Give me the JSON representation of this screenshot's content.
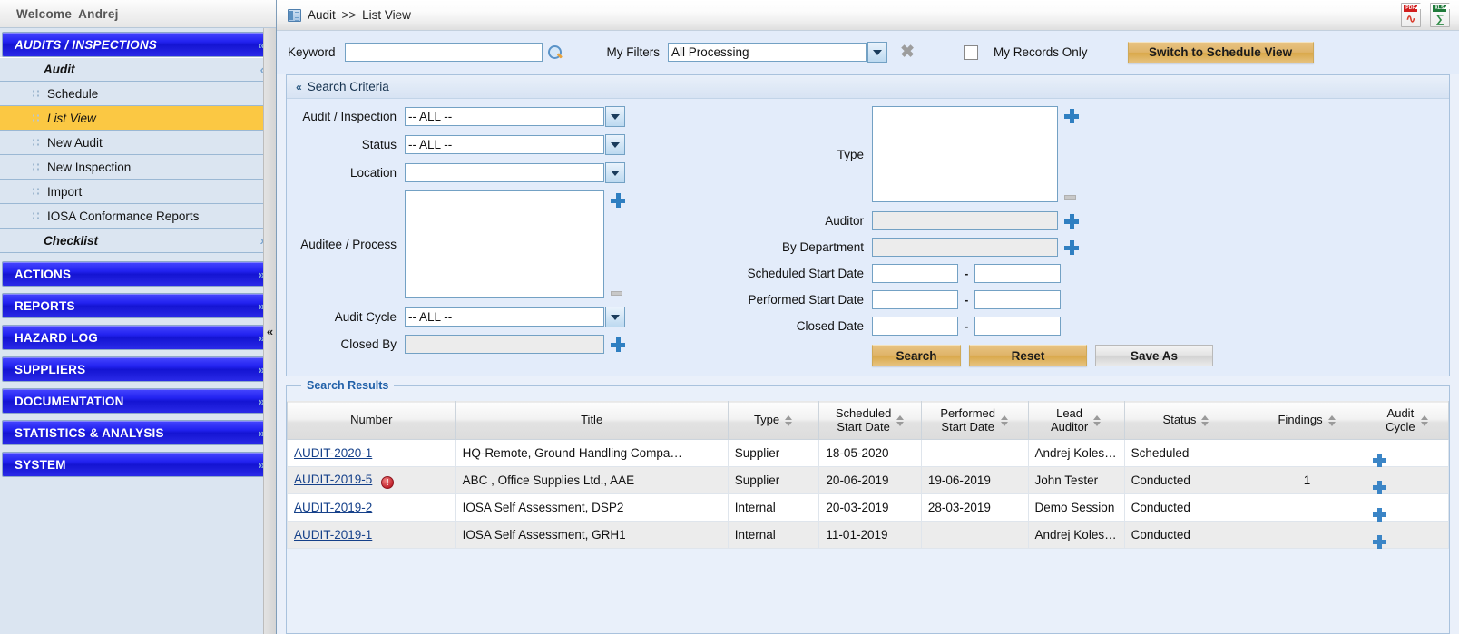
{
  "sidebar": {
    "welcome_prefix": "Welcome",
    "welcome_user": "Andrej",
    "groups": [
      {
        "label": "AUDITS / INSPECTIONS",
        "expanded": true
      },
      {
        "label": "ACTIONS",
        "expanded": false
      },
      {
        "label": "REPORTS",
        "expanded": false
      },
      {
        "label": "HAZARD LOG",
        "expanded": false
      },
      {
        "label": "SUPPLIERS",
        "expanded": false
      },
      {
        "label": "DOCUMENTATION",
        "expanded": false
      },
      {
        "label": "STATISTICS & ANALYSIS",
        "expanded": false
      },
      {
        "label": "SYSTEM",
        "expanded": false
      }
    ],
    "audit_section": "Audit",
    "checklist_section": "Checklist",
    "items": [
      {
        "label": "Schedule",
        "active": false
      },
      {
        "label": "List View",
        "active": true
      },
      {
        "label": "New Audit",
        "active": false
      },
      {
        "label": "New Inspection",
        "active": false
      },
      {
        "label": "Import",
        "active": false
      },
      {
        "label": "IOSA Conformance Reports",
        "active": false
      }
    ],
    "collapse_glyph": "«",
    "expand_glyph": "»",
    "chev_up": "»",
    "chev_down": "»"
  },
  "topbar": {
    "breadcrumb_root": "Audit",
    "breadcrumb_sep": ">>",
    "breadcrumb_leaf": "List View",
    "pdf_tag": "PDF",
    "pdf_glyph": "▉",
    "xls_tag": "XLS",
    "xls_glyph": "▉"
  },
  "filterbar": {
    "keyword_label": "Keyword",
    "keyword_value": "",
    "keyword_placeholder": "",
    "my_filters_label": "My Filters",
    "my_filters_value": "All Processing",
    "clear_glyph": "✖",
    "my_records_label": "My Records Only",
    "my_records_checked": false,
    "switch_view_button": "Switch to Schedule View"
  },
  "criteria": {
    "panel_title": "Search Criteria",
    "collapse_glyph": "«",
    "left": {
      "audit_inspection_label": "Audit / Inspection",
      "audit_inspection_value": "-- ALL --",
      "status_label": "Status",
      "status_value": "-- ALL --",
      "location_label": "Location",
      "location_value": "",
      "auditee_label": "Auditee / Process",
      "auditee_value": "",
      "audit_cycle_label": "Audit Cycle",
      "audit_cycle_value": "-- ALL --",
      "closed_by_label": "Closed By",
      "closed_by_value": ""
    },
    "right": {
      "type_label": "Type",
      "type_value": "",
      "auditor_label": "Auditor",
      "auditor_value": "",
      "by_department_label": "By Department",
      "by_department_value": "",
      "scheduled_start_label": "Scheduled Start Date",
      "scheduled_start_from": "",
      "scheduled_start_to": "",
      "performed_start_label": "Performed Start Date",
      "performed_start_from": "",
      "performed_start_to": "",
      "closed_date_label": "Closed Date",
      "closed_date_from": "",
      "closed_date_to": "",
      "range_sep": "-"
    },
    "buttons": {
      "search": "Search",
      "reset": "Reset",
      "save_as": "Save As"
    }
  },
  "results": {
    "legend": "Search Results",
    "columns": [
      {
        "label": "Number",
        "sortable": false
      },
      {
        "label": "Title",
        "sortable": false
      },
      {
        "label": "Type",
        "sortable": true
      },
      {
        "label": "Scheduled\nStart Date",
        "line1": "Scheduled",
        "line2": "Start Date",
        "sortable": true
      },
      {
        "label": "Performed\nStart Date",
        "line1": "Performed",
        "line2": "Start Date",
        "sortable": true
      },
      {
        "label": "Lead\nAuditor",
        "line1": "Lead",
        "line2": "Auditor",
        "sortable": true
      },
      {
        "label": "Status",
        "sortable": true
      },
      {
        "label": "Findings",
        "sortable": true
      },
      {
        "label": "Audit\nCycle",
        "line1": "Audit",
        "line2": "Cycle",
        "sortable": true
      }
    ],
    "rows": [
      {
        "number": "AUDIT-2020-1",
        "warning": false,
        "title": "HQ-Remote, Ground Handling Compa…",
        "type": "Supplier",
        "scheduled_start_date": "18-05-2020",
        "performed_start_date": "",
        "lead_auditor": "Andrej Koles…",
        "status": "Scheduled",
        "findings": "",
        "audit_cycle_icon": "plus-icon"
      },
      {
        "number": "AUDIT-2019-5",
        "warning": true,
        "warning_glyph": "!",
        "title": "ABC , Office Supplies Ltd., AAE",
        "type": "Supplier",
        "scheduled_start_date": "20-06-2019",
        "performed_start_date": "19-06-2019",
        "lead_auditor": "John Tester",
        "status": "Conducted",
        "findings": "1",
        "audit_cycle_icon": "plus-icon"
      },
      {
        "number": "AUDIT-2019-2",
        "warning": false,
        "title": "IOSA Self Assessment, DSP2",
        "type": "Internal",
        "scheduled_start_date": "20-03-2019",
        "performed_start_date": "28-03-2019",
        "lead_auditor": "Demo Session",
        "status": "Conducted",
        "findings": "",
        "audit_cycle_icon": "plus-icon"
      },
      {
        "number": "AUDIT-2019-1",
        "warning": false,
        "title": "IOSA Self Assessment, GRH1",
        "type": "Internal",
        "scheduled_start_date": "11-01-2019",
        "performed_start_date": "",
        "lead_auditor": "Andrej Koles…",
        "status": "Conducted",
        "findings": "",
        "audit_cycle_icon": "plus-icon"
      }
    ]
  },
  "colors": {
    "nav_blue": "#2222f0",
    "active_yellow": "#fbc843",
    "gold_button": "#dfb469",
    "link_blue": "#16418a",
    "panel_bg": "#e3ecfa"
  }
}
